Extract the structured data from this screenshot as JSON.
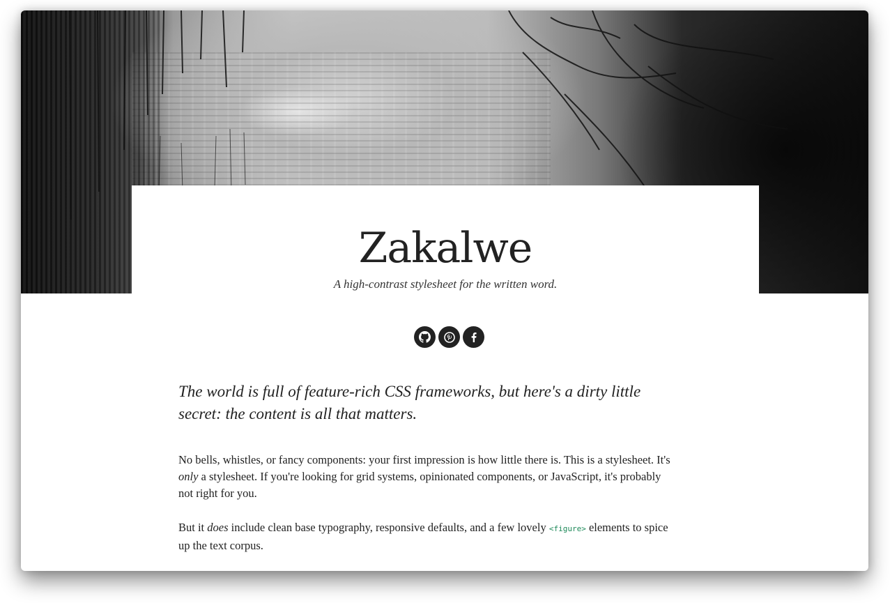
{
  "header": {
    "title": "Zakalwe",
    "tagline": "A high-contrast stylesheet for the written word."
  },
  "social": [
    {
      "name": "github",
      "icon": "github-icon"
    },
    {
      "name": "pinterest",
      "icon": "pinterest-icon"
    },
    {
      "name": "facebook",
      "icon": "facebook-icon"
    }
  ],
  "content": {
    "lead": "The world is full of feature-rich CSS frameworks, but here's a dirty little secret: the content is all that matters.",
    "p1_a": "No bells, whistles, or fancy components: your first impression is how little there is. This is a stylesheet. It's ",
    "p1_em": "only",
    "p1_b": " a stylesheet. If you're looking for grid systems, opinionated components, or JavaScript, it's probably not right for you.",
    "p2_a": "But it ",
    "p2_em": "does",
    "p2_b": " include clean base typography, responsive defaults, and a few lovely ",
    "p2_code": "<figure>",
    "p2_c": " elements to spice up the text corpus."
  },
  "colors": {
    "text": "#222222",
    "icon_bg": "#222222",
    "code": "#1f8a5a"
  }
}
